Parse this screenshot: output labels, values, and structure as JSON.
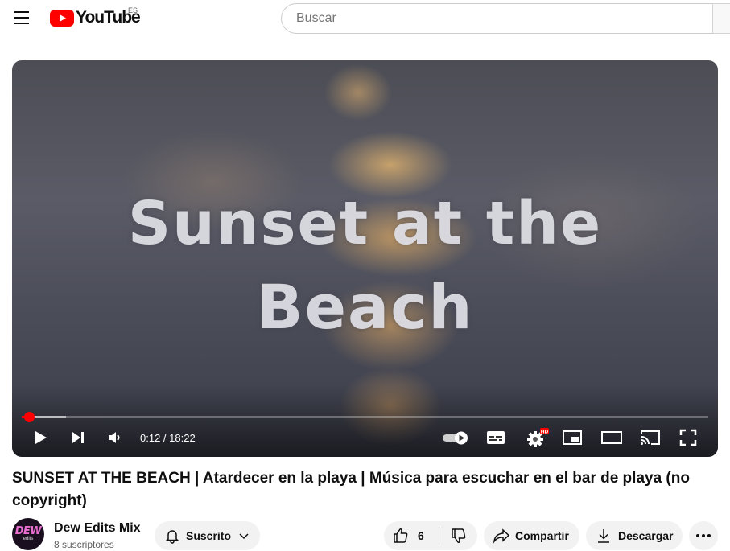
{
  "header": {
    "logo_text": "YouTube",
    "country_code": "ES",
    "search_placeholder": "Buscar",
    "brand_color": "#ff0000"
  },
  "player": {
    "thumbnail_text_line1": "Sunset at the",
    "thumbnail_text_line2": "Beach",
    "time_current": "0:12",
    "time_total": "18:22",
    "time_display": "0:12 / 18:22",
    "progress_fraction": 0.011,
    "buffered_fraction": 0.065,
    "hd_badge": "HD"
  },
  "video": {
    "title": "SUNSET AT THE BEACH | Atardecer en la playa | Música para escuchar en el bar de playa (no copyright)"
  },
  "channel": {
    "name": "Dew Edits Mix",
    "subscribers": "8 suscriptores",
    "avatar_text": "DEW",
    "avatar_subtext": "edits",
    "subscribe_label": "Suscrito"
  },
  "actions": {
    "likes": "6",
    "share_label": "Compartir",
    "download_label": "Descargar"
  }
}
